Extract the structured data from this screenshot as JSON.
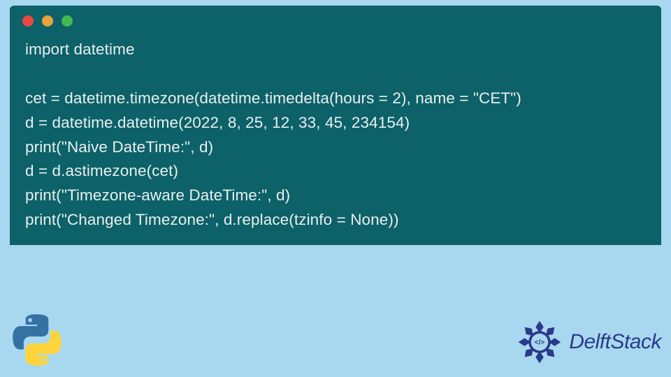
{
  "code": {
    "lines": [
      "import datetime",
      "",
      "cet = datetime.timezone(datetime.timedelta(hours = 2), name = \"CET\")",
      "d = datetime.datetime(2022, 8, 25, 12, 33, 45, 234154)",
      "print(\"Naive DateTime:\", d)",
      "d = d.astimezone(cet)",
      "print(\"Timezone-aware DateTime:\", d)",
      "print(\"Changed Timezone:\", d.replace(tzinfo = None))"
    ]
  },
  "brand": {
    "name": "DelftStack"
  },
  "colors": {
    "page_bg": "#a8d8f0",
    "code_bg": "#0d6168",
    "code_fg": "#e8f0f0",
    "brand_fg": "#2a3a8a"
  }
}
